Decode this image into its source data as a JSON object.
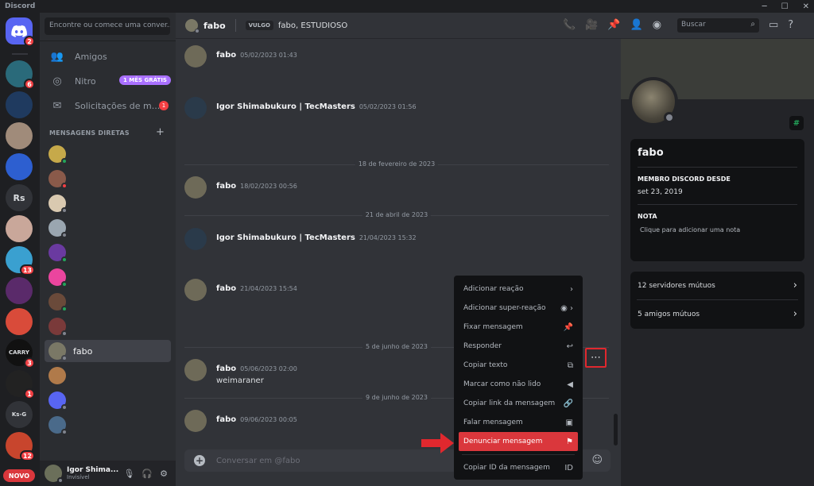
{
  "app": {
    "title": "Discord"
  },
  "servers": {
    "home_badge": "2",
    "items": [
      {
        "color": "#2a6a7a",
        "badge": "6"
      },
      {
        "color": "#1f3a5f",
        "badge": ""
      },
      {
        "color": "#a08b7a",
        "badge": ""
      },
      {
        "color": "#2d5fd0",
        "badge": ""
      },
      {
        "color": "#313338",
        "text": "Rs",
        "badge": ""
      },
      {
        "color": "#c9a79a",
        "badge": ""
      },
      {
        "color": "#3aa0d0",
        "badge": "13"
      },
      {
        "color": "#5a2a6a",
        "badge": ""
      },
      {
        "color": "#d94b3a",
        "badge": ""
      },
      {
        "color": "#111111",
        "text": "CARRY",
        "badge": "3"
      },
      {
        "color": "#222222",
        "badge": "1"
      },
      {
        "color": "#313338",
        "text": "Ks-G",
        "badge": ""
      },
      {
        "color": "#c8452d",
        "badge": "12"
      }
    ],
    "new_label": "NOVO"
  },
  "dm_sidebar": {
    "search_placeholder": "Encontre ou comece uma conver...",
    "nav": [
      {
        "label": "Amigos",
        "icon": "friends-icon"
      },
      {
        "label": "Nitro",
        "icon": "nitro-icon",
        "badge": "1 MÊS GRÁTIS"
      },
      {
        "label": "Solicitações de m...",
        "icon": "envelope-icon",
        "count": "1"
      }
    ],
    "dm_header": "MENSAGENS DIRETAS",
    "dms": [
      {
        "name": "",
        "color": "#c6a94a",
        "status": "#23a55a"
      },
      {
        "name": "",
        "color": "#8a5a4a",
        "status": "#f23f43"
      },
      {
        "name": "",
        "color": "#d9c9b0",
        "status": "#80848e"
      },
      {
        "name": "",
        "color": "#9aa6b0",
        "status": "#80848e"
      },
      {
        "name": "",
        "color": "#6a3aa0",
        "status": "#23a55a"
      },
      {
        "name": "",
        "color": "#eb459e",
        "status": "#23a55a"
      },
      {
        "name": "",
        "color": "#6a4a3a",
        "status": "#23a55a"
      },
      {
        "name": "",
        "color": "#7a3a3a",
        "status": "#80848e"
      },
      {
        "name": "fabo",
        "color": "#7a7866",
        "status": "#80848e"
      },
      {
        "name": "",
        "color": "#b07a4a",
        "status": ""
      },
      {
        "name": "",
        "color": "#5865f2",
        "status": "#80848e"
      },
      {
        "name": "",
        "color": "#4a6a8a",
        "status": "#80848e"
      }
    ],
    "user": {
      "name": "Igor Shima...",
      "status": "Invisível"
    }
  },
  "chat_header": {
    "name": "fabo",
    "vulgo_label": "VULGO",
    "nicknames": "fabo, ESTUDIOSO",
    "search_placeholder": "Buscar"
  },
  "messages": [
    {
      "author": "fabo",
      "time": "05/02/2023 01:43",
      "text": ""
    },
    {
      "author": "Igor Shimabukuro | TecMasters",
      "time": "05/02/2023 01:56",
      "text": ""
    },
    {
      "author": "fabo",
      "time": "18/02/2023 00:56",
      "text": ""
    },
    {
      "author": "Igor Shimabukuro | TecMasters",
      "time": "21/04/2023 15:32",
      "text": ""
    },
    {
      "author": "fabo",
      "time": "21/04/2023 15:54",
      "text": ""
    },
    {
      "author": "fabo",
      "time": "05/06/2023 02:00",
      "text": "weimaraner"
    },
    {
      "author": "fabo",
      "time": "09/06/2023 00:05",
      "text": ""
    }
  ],
  "date_separators": [
    "18 de fevereiro de 2023",
    "21 de abril de 2023",
    "5 de junho de 2023",
    "9 de junho de 2023"
  ],
  "composer": {
    "placeholder": "Conversar em @fabo"
  },
  "context_menu": {
    "items": [
      {
        "label": "Adicionar reação",
        "icon": "chevron-right-icon"
      },
      {
        "label": "Adicionar super-reação",
        "icon": "chevron-right-icon"
      },
      {
        "label": "Fixar mensagem",
        "icon": "pin-icon"
      },
      {
        "label": "Responder",
        "icon": "reply-icon"
      },
      {
        "label": "Copiar texto",
        "icon": "copy-icon"
      },
      {
        "label": "Marcar como não lido",
        "icon": "unread-icon"
      },
      {
        "label": "Copiar link da mensagem",
        "icon": "link-icon"
      },
      {
        "label": "Falar mensagem",
        "icon": "speak-icon"
      },
      {
        "label": "Denunciar mensagem",
        "icon": "flag-icon"
      },
      {
        "label": "Copiar ID da mensagem",
        "icon": "id-icon"
      }
    ]
  },
  "profile": {
    "name": "fabo",
    "member_since_label": "MEMBRO DISCORD DESDE",
    "member_since": "set 23, 2019",
    "note_label": "NOTA",
    "note_placeholder": "Clique para adicionar uma nota",
    "mutual_servers": "12 servidores mútuos",
    "mutual_friends": "5 amigos mútuos"
  },
  "colors": {
    "danger": "#da373c",
    "accent": "#5865f2",
    "highlight": "#e0282e"
  }
}
